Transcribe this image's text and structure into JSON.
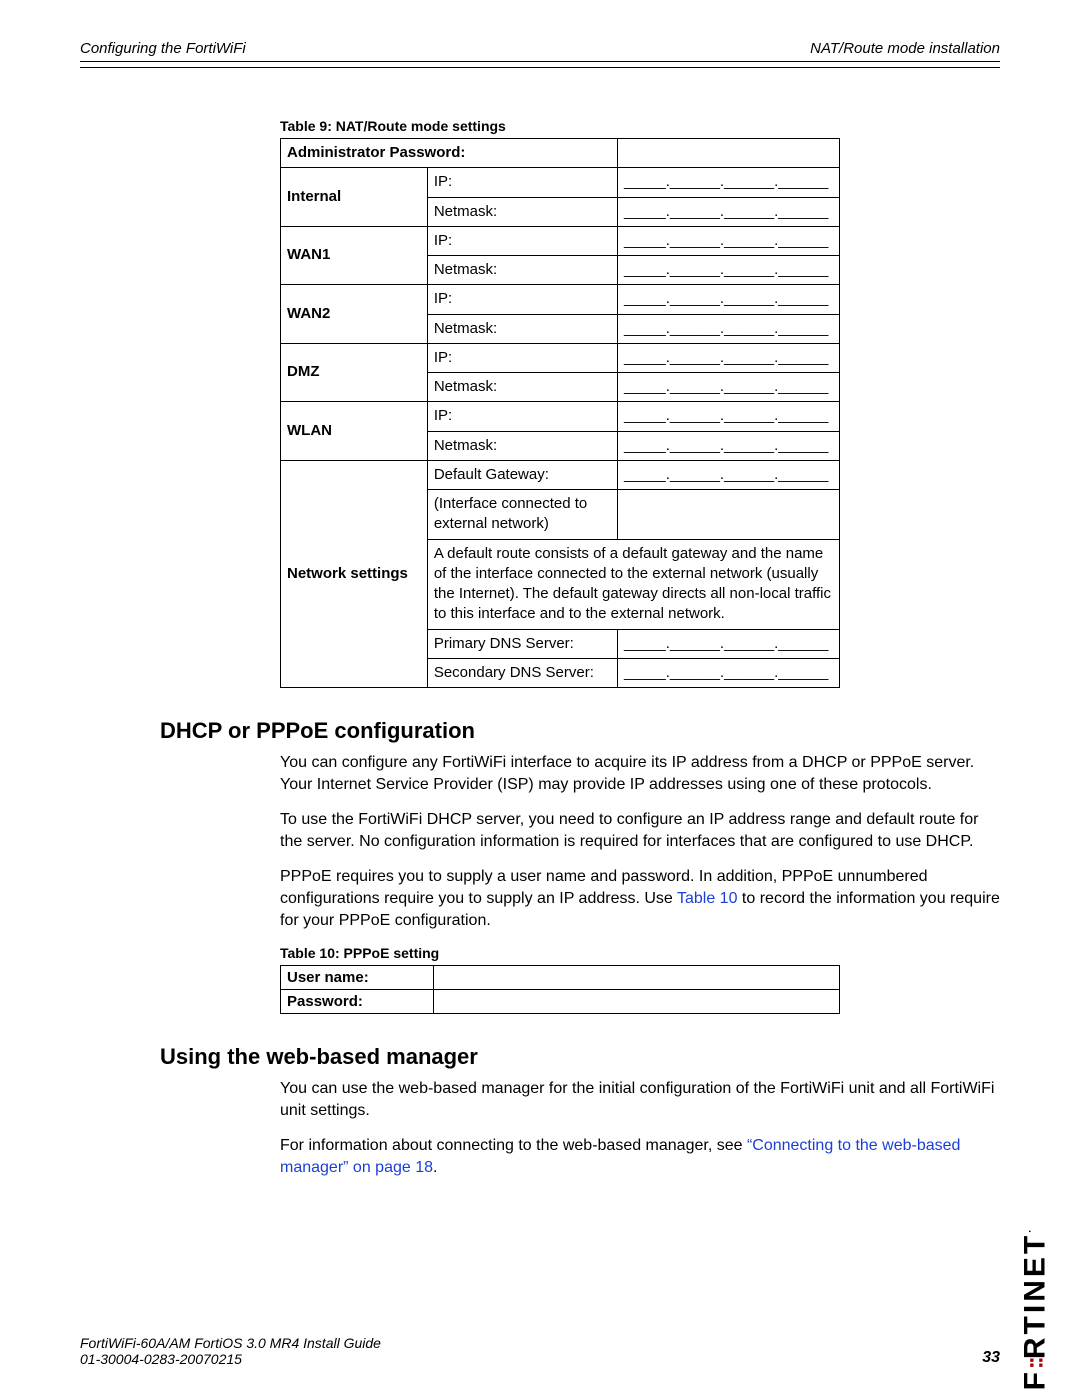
{
  "header": {
    "left": "Configuring the FortiWiFi",
    "right": "NAT/Route mode installation"
  },
  "table9": {
    "caption": "Table 9: NAT/Route mode settings",
    "admin_password": "Administrator Password:",
    "ip_label": "IP:",
    "netmask_label": "Netmask:",
    "blank": "_____.______.______.______",
    "interfaces": {
      "internal": "Internal",
      "wan1": "WAN1",
      "wan2": "WAN2",
      "dmz": "DMZ",
      "wlan": "WLAN"
    },
    "network_settings": "Network settings",
    "default_gateway": "Default Gateway:",
    "iface_note": "(Interface connected to external network)",
    "route_note": "A default route consists of a default gateway and the name of the interface connected to the external network (usually the Internet). The default gateway directs all non-local traffic to this interface and to the external network.",
    "primary_dns": "Primary DNS Server:",
    "secondary_dns": "Secondary DNS Server:"
  },
  "section1": {
    "title": "DHCP or PPPoE configuration",
    "p1": "You can configure any FortiWiFi interface to acquire its IP address from a DHCP or PPPoE server. Your Internet Service Provider (ISP) may provide IP addresses using one of these protocols.",
    "p2": "To use the FortiWiFi DHCP server, you need to configure an IP address range and default route for the server. No configuration information is required for interfaces that are configured to use DHCP.",
    "p3a": "PPPoE requires you to supply a user name and password. In addition, PPPoE unnumbered configurations require you to supply an IP address. Use ",
    "p3_link": "Table 10",
    "p3b": " to record the information you require for your PPPoE configuration."
  },
  "table10": {
    "caption": "Table 10: PPPoE setting",
    "username": "User name:",
    "password": "Password:"
  },
  "section2": {
    "title": "Using the web-based manager",
    "p1": "You can use the web-based manager for the initial configuration of the FortiWiFi unit and all FortiWiFi unit settings.",
    "p2a": "For information about connecting to the web-based manager, see ",
    "p2_link": "“Connecting to the web-based manager” on page 18",
    "p2b": "."
  },
  "footer": {
    "line1": "FortiWiFi-60A/AM FortiOS 3.0 MR4 Install Guide",
    "line2": "01-30004-0283-20070215",
    "page": "33"
  },
  "logo": {
    "left": "F",
    "dots": "::",
    "right": "RTINET"
  }
}
